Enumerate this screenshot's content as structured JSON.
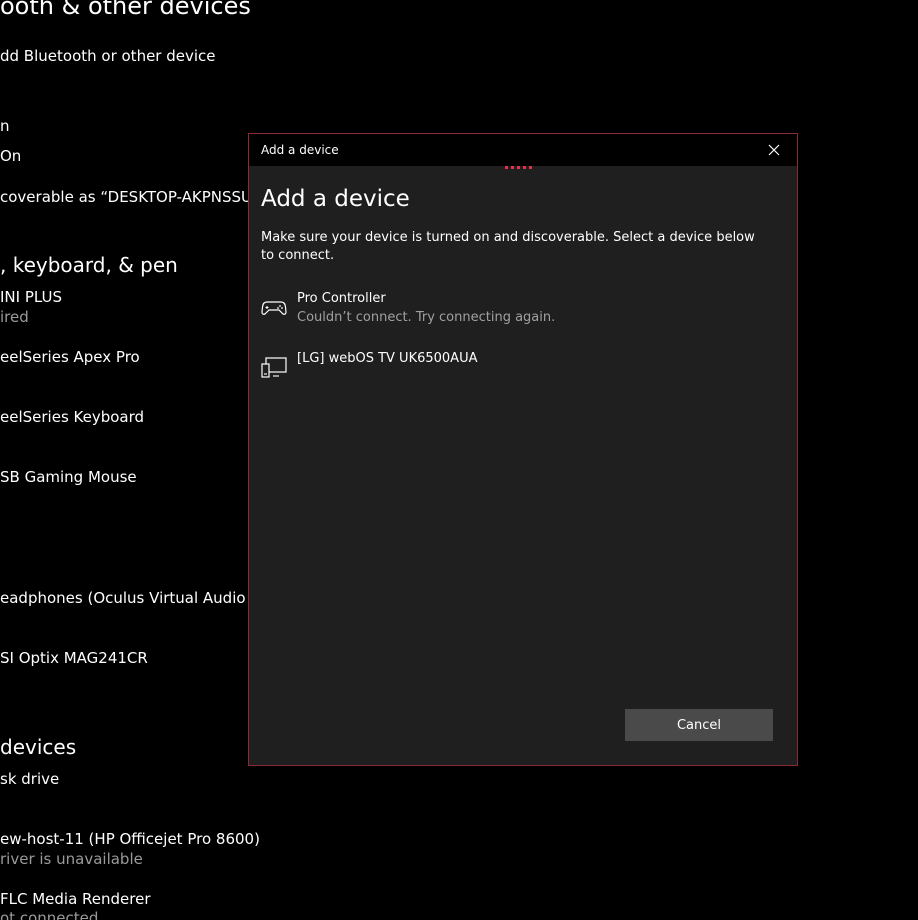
{
  "background": {
    "title": "ooth & other devices",
    "add_label": "dd Bluetooth or other device",
    "bluetooth_label": "n",
    "bluetooth_state": "On",
    "discoverable": "coverable as “DESKTOP-AKPNSSU”",
    "section_mouse": ", keyboard, & pen",
    "items": [
      {
        "name": "INI PLUS",
        "status": "ired"
      },
      {
        "name": "eelSeries Apex Pro",
        "status": ""
      },
      {
        "name": "eelSeries Keyboard",
        "status": ""
      },
      {
        "name": "SB Gaming Mouse",
        "status": ""
      },
      {
        "name": "eadphones (Oculus Virtual Audio Devi",
        "status": ""
      },
      {
        "name": "SI Optix MAG241CR",
        "status": ""
      }
    ],
    "section_other": "devices",
    "other_items": [
      {
        "name": "sk drive",
        "status": ""
      },
      {
        "name": "ew-host-11 (HP Officejet Pro 8600)",
        "status": "river is unavailable"
      },
      {
        "name": "FLC Media Renderer",
        "status": "ot connected"
      }
    ]
  },
  "dialog": {
    "window_title": "Add a device",
    "heading": "Add a device",
    "description": "Make sure your device is turned on and discoverable. Select a device below to connect.",
    "devices": [
      {
        "name": "Pro Controller",
        "status": "Couldn’t connect. Try connecting again.",
        "icon": "gamepad-icon"
      },
      {
        "name": "[LG] webOS TV UK6500AUA",
        "status": "",
        "icon": "display-device-icon"
      }
    ],
    "cancel_label": "Cancel"
  },
  "colors": {
    "accent": "#e0324a",
    "dialog_border": "#8a2b37",
    "dialog_bg": "#1f1f1f",
    "button_bg": "#4a4a4a"
  }
}
